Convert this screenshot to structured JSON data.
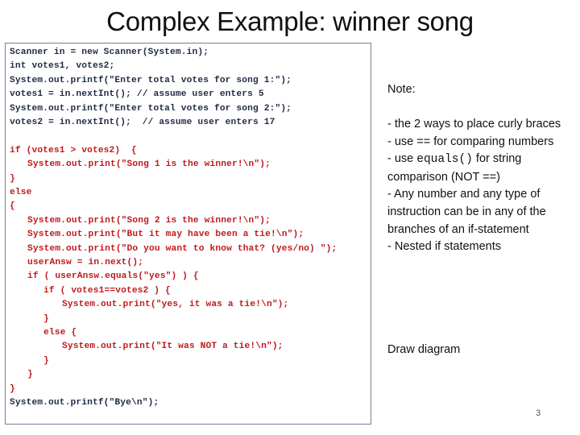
{
  "slide": {
    "title": "Complex Example: winner song",
    "page_number": "3"
  },
  "code": {
    "lines": [
      {
        "text": "Scanner in = new Scanner(System.in);",
        "indent": 0,
        "color": "dark"
      },
      {
        "text": "int votes1, votes2;",
        "indent": 0,
        "color": "dark"
      },
      {
        "text": "System.out.printf(\"Enter total votes for song 1:\");",
        "indent": 0,
        "color": "dark"
      },
      {
        "text": "votes1 = in.nextInt(); // assume user enters 5",
        "indent": 0,
        "color": "dark"
      },
      {
        "text": "System.out.printf(\"Enter total votes for song 2:\");",
        "indent": 0,
        "color": "dark"
      },
      {
        "text": "votes2 = in.nextInt();  // assume user enters 17",
        "indent": 0,
        "color": "dark"
      },
      {
        "text": "",
        "indent": 0,
        "color": "dark"
      },
      {
        "text": "if (votes1 > votes2)  {",
        "indent": 0,
        "color": "red"
      },
      {
        "text": "System.out.print(\"Song 1 is the winner!\\n\");",
        "indent": 1,
        "color": "red"
      },
      {
        "text": "}",
        "indent": 0,
        "color": "red"
      },
      {
        "text": "else",
        "indent": 0,
        "color": "red"
      },
      {
        "text": "{",
        "indent": 0,
        "color": "red"
      },
      {
        "text": "System.out.print(\"Song 2 is the winner!\\n\");",
        "indent": 1,
        "color": "red"
      },
      {
        "text": "System.out.print(\"But it may have been a tie!\\n\");",
        "indent": 1,
        "color": "red"
      },
      {
        "text": "System.out.print(\"Do you want to know that? (yes/no) \");",
        "indent": 1,
        "color": "red"
      },
      {
        "text": "userAnsw = in.next();",
        "indent": 1,
        "color": "red"
      },
      {
        "text": "if ( userAnsw.equals(\"yes\") ) {",
        "indent": 1,
        "color": "red"
      },
      {
        "text": "if ( votes1==votes2 ) {",
        "indent": 2,
        "color": "red"
      },
      {
        "text": "System.out.print(\"yes, it was a tie!\\n\");",
        "indent": 3,
        "color": "red"
      },
      {
        "text": "}",
        "indent": 2,
        "color": "red"
      },
      {
        "text": "else {",
        "indent": 2,
        "color": "red"
      },
      {
        "text": "System.out.print(\"It was NOT a tie!\\n\");",
        "indent": 3,
        "color": "red"
      },
      {
        "text": "}",
        "indent": 2,
        "color": "red"
      },
      {
        "text": "}",
        "indent": 1,
        "color": "red"
      },
      {
        "text": "}",
        "indent": 0,
        "color": "red"
      },
      {
        "text": "System.out.printf(\"Bye\\n\");",
        "indent": 0,
        "color": "dark"
      }
    ]
  },
  "notes": {
    "heading": "Note:",
    "items": [
      {
        "parts": [
          {
            "text": "- the 2 ways to place curly braces",
            "mono": false
          }
        ]
      },
      {
        "parts": [
          {
            "text": "- use == for comparing numbers",
            "mono": false
          }
        ]
      },
      {
        "parts": [
          {
            "text": "- use ",
            "mono": false
          },
          {
            "text": "equals()",
            "mono": true
          },
          {
            "text": " for string comparison (NOT ==)",
            "mono": false
          }
        ]
      },
      {
        "parts": [
          {
            "text": "- Any number  and any type of instruction can be in any of the branches of an if-statement",
            "mono": false
          }
        ]
      },
      {
        "parts": [
          {
            "text": "- Nested if statements",
            "mono": false
          }
        ]
      }
    ],
    "footer": "Draw diagram"
  },
  "colors": {
    "code_dark": "#1f2a44",
    "code_red": "#c0191c",
    "box_border": "#6e8396"
  }
}
